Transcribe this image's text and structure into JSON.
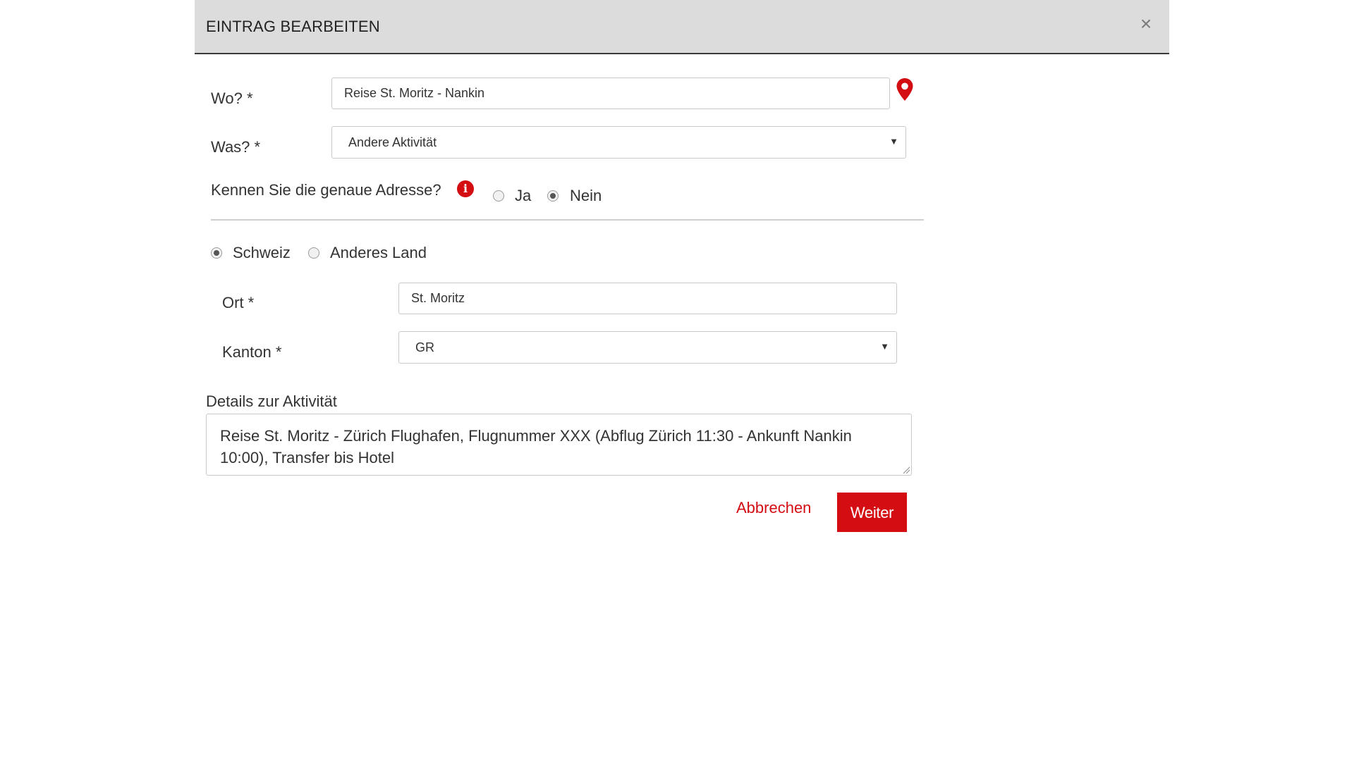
{
  "dialog": {
    "title": "EINTRAG BEARBEITEN",
    "close_symbol": "×",
    "close_icon": "close-icon"
  },
  "form": {
    "where": {
      "label": "Wo? *",
      "value": "Reise St. Moritz - Nankin",
      "icon": "map-pin-icon"
    },
    "what": {
      "label": "Was? *",
      "selected": "Andere Aktivität"
    },
    "exact_address": {
      "question": "Kennen Sie die genaue Adresse?",
      "info_icon": "info-icon",
      "info_symbol": "i",
      "options": [
        {
          "label": "Ja",
          "checked": false
        },
        {
          "label": "Nein",
          "checked": true
        }
      ]
    },
    "country": {
      "options": [
        {
          "label": "Schweiz",
          "checked": true
        },
        {
          "label": "Anderes Land",
          "checked": false
        }
      ]
    },
    "place": {
      "label": "Ort *",
      "value": "St. Moritz"
    },
    "canton": {
      "label": "Kanton *",
      "selected": "GR"
    },
    "details": {
      "label": "Details zur Aktivität",
      "value": "Reise St. Moritz - Zürich Flughafen, Flugnummer XXX (Abflug Zürich 11:30 - Ankunft Nankin 10:00), Transfer bis Hotel"
    }
  },
  "actions": {
    "cancel_label": "Abbrechen",
    "next_label": "Weiter"
  },
  "colors": {
    "accent": "#d40d12",
    "header_bg": "#dcdcdc"
  }
}
